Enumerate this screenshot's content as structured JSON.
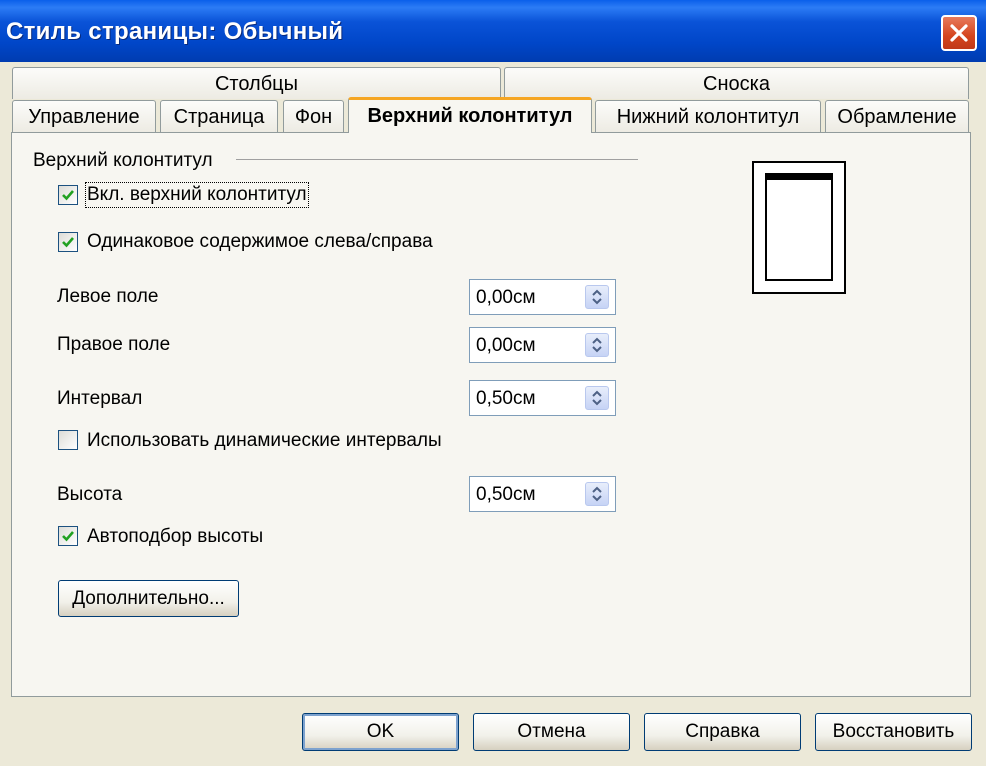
{
  "window": {
    "title": "Стиль страницы: Обычный"
  },
  "tabs_row1": [
    {
      "label": "Столбцы"
    },
    {
      "label": "Сноска"
    }
  ],
  "tabs_row2": [
    {
      "label": "Управление"
    },
    {
      "label": "Страница"
    },
    {
      "label": "Фон"
    },
    {
      "label": "Верхний колонтитул",
      "active": true
    },
    {
      "label": "Нижний колонтитул"
    },
    {
      "label": "Обрамление"
    }
  ],
  "section": {
    "title": "Верхний колонтитул"
  },
  "checkboxes": {
    "enable_header": {
      "label": "Вкл. верхний колонтитул",
      "checked": true
    },
    "same_content": {
      "label": "Одинаковое содержимое слева/справа",
      "checked": true
    },
    "dynamic_spacing": {
      "label": "Использовать динамические интервалы",
      "checked": false
    },
    "autofit_height": {
      "label": "Автоподбор высоты",
      "checked": true
    }
  },
  "fields": {
    "left_margin": {
      "label": "Левое поле",
      "value": "0,00см"
    },
    "right_margin": {
      "label": "Правое поле",
      "value": "0,00см"
    },
    "spacing": {
      "label": "Интервал",
      "value": "0,50см"
    },
    "height": {
      "label": "Высота",
      "value": "0,50см"
    }
  },
  "more_button": {
    "label": "Дополнительно..."
  },
  "buttons": {
    "ok": "OK",
    "cancel": "Отмена",
    "help": "Справка",
    "reset": "Восстановить"
  },
  "icons": {
    "close": "close-icon",
    "check": "check-icon",
    "spin": "spin-arrows-icon"
  },
  "colors": {
    "titlebar": "#0054E3",
    "active_tab_accent": "#F5A623",
    "dialog_bg": "#ECE9D8",
    "close_button": "#D4451E"
  }
}
